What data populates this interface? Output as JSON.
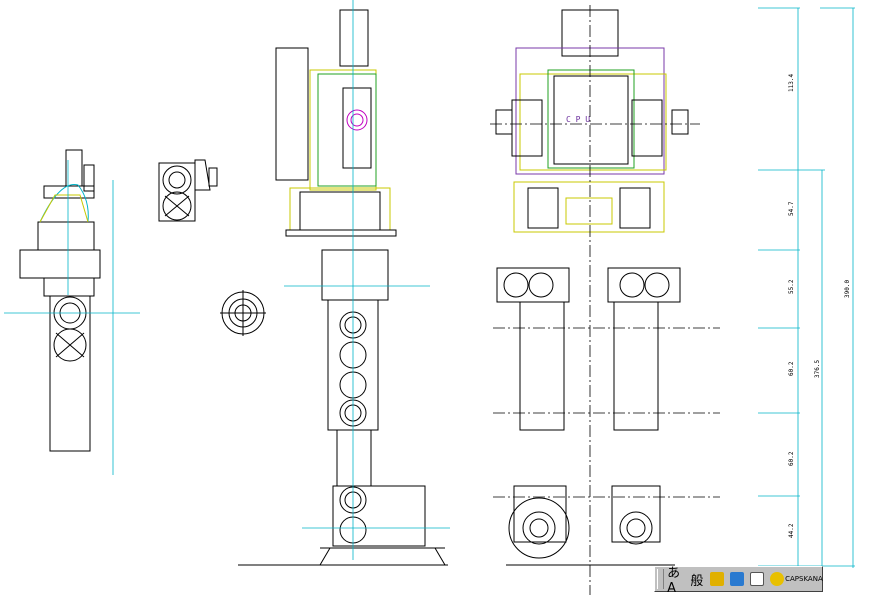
{
  "drawing": {
    "cpu_label": "C P U",
    "dimensions": {
      "d1": "113.4",
      "d2": "54.7",
      "d3": "55.2",
      "d4": "60.2",
      "d5": "60.2",
      "d6": "44.2",
      "d7": "376.5",
      "d8": "390.0"
    }
  },
  "ime_toolbar": {
    "mode_label": "あA",
    "kanji_label": "般",
    "caps_label": "CAPS",
    "kana_label": "KANA"
  },
  "colors": {
    "line": "#000000",
    "centerline": "#00b4c8",
    "outline_yellow": "#c8c800",
    "outline_green": "#20a020",
    "outline_purple": "#7a3aa8",
    "outline_magenta": "#c000c0"
  }
}
